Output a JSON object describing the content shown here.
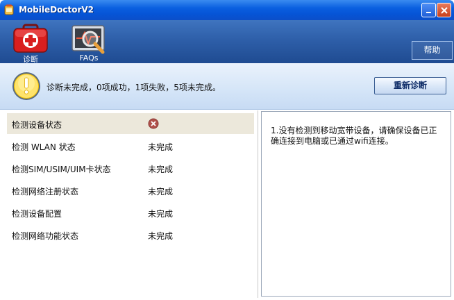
{
  "window": {
    "title": "MobileDoctorV2"
  },
  "toolbar": {
    "items": [
      {
        "label": "诊断",
        "icon": "medical-kit-icon"
      },
      {
        "label": "FAQs",
        "icon": "monitor-magnifier-icon"
      }
    ],
    "help_label": "帮助"
  },
  "status": {
    "message": "诊断未完成，0项成功，1项失败，5项未完成。",
    "rediagnose_label": "重新诊断",
    "icon": "warning-icon"
  },
  "checks": [
    {
      "name": "检测设备状态",
      "status": "",
      "state": "failed",
      "icon": "fail-icon"
    },
    {
      "name": "检测 WLAN 状态",
      "status": "未完成",
      "state": "incomplete"
    },
    {
      "name": "检测SIM/USIM/UIM卡状态",
      "status": "未完成",
      "state": "incomplete"
    },
    {
      "name": "检测网络注册状态",
      "status": "未完成",
      "state": "incomplete"
    },
    {
      "name": "检测设备配置",
      "status": "未完成",
      "state": "incomplete"
    },
    {
      "name": "检测网络功能状态",
      "status": "未完成",
      "state": "incomplete"
    }
  ],
  "details": {
    "text": "1.没有检测到移动宽带设备，请确保设备已正确连接到电脑或已通过wifi连接。"
  },
  "colors": {
    "titlebar": "#0654d6",
    "toolbar": "#2e5fa9",
    "banner": "#d6e6f8",
    "selected_row": "#ece8db",
    "fail": "#b0504a"
  }
}
